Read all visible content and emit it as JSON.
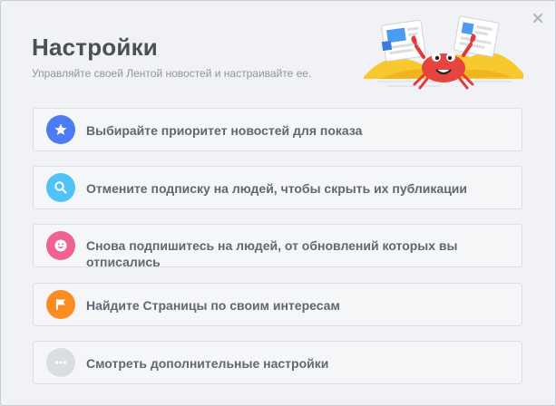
{
  "dialog": {
    "title": "Настройки",
    "subtitle": "Управляйте своей Лентой новостей и настраивайте ее."
  },
  "options": [
    {
      "label": "Выбирайте приоритет новостей для показа",
      "icon": "star-icon",
      "color": "#4c7cf3"
    },
    {
      "label": "Отмените подписку на людей, чтобы скрыть их публикации",
      "icon": "search-icon",
      "color": "#4fc3f7"
    },
    {
      "label": "Снова подпишитесь на людей, от обновлений которых вы отписались",
      "icon": "smiley-icon",
      "color": "#f06292"
    },
    {
      "label": "Найдите Страницы по своим интересам",
      "icon": "flag-icon",
      "color": "#fb8c23"
    },
    {
      "label": "Смотреть дополнительные настройки",
      "icon": "more-icon",
      "color": "#dadde1"
    }
  ]
}
